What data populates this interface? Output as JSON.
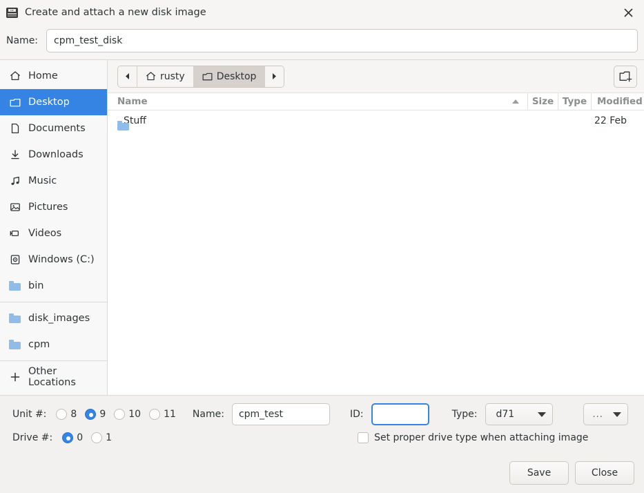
{
  "window": {
    "title": "Create and attach a new disk image",
    "icon": "disk-drive-icon",
    "close_icon": "close-icon",
    "accent_color": "#3584e4"
  },
  "name_row": {
    "label": "Name:",
    "value": "cpm_test_disk",
    "placeholder": ""
  },
  "sidebar": {
    "groups": [
      {
        "items": [
          {
            "label": "Home",
            "icon": "home-icon",
            "selected": false
          },
          {
            "label": "Desktop",
            "icon": "folder-outline-icon",
            "selected": true
          },
          {
            "label": "Documents",
            "icon": "document-icon",
            "selected": false
          },
          {
            "label": "Downloads",
            "icon": "download-icon",
            "selected": false
          },
          {
            "label": "Music",
            "icon": "music-note-icon",
            "selected": false
          },
          {
            "label": "Pictures",
            "icon": "picture-icon",
            "selected": false
          },
          {
            "label": "Videos",
            "icon": "video-camera-icon",
            "selected": false
          },
          {
            "label": "Windows (C:)",
            "icon": "drive-icon",
            "selected": false
          },
          {
            "label": "bin",
            "icon": "folder-icon",
            "selected": false
          }
        ]
      },
      {
        "items": [
          {
            "label": "disk_images",
            "icon": "folder-icon",
            "selected": false
          },
          {
            "label": "cpm",
            "icon": "folder-icon",
            "selected": false
          }
        ]
      },
      {
        "items": [
          {
            "label": "Other Locations",
            "icon": "plus-icon",
            "selected": false
          }
        ]
      }
    ]
  },
  "pathbar": {
    "back_icon": "chevron-left-icon",
    "forward_icon": "chevron-right-icon",
    "crumbs": [
      {
        "label": "rusty",
        "icon": "home-icon",
        "active": false
      },
      {
        "label": "Desktop",
        "icon": "folder-outline-icon",
        "active": true
      }
    ],
    "new_folder_icon": "new-folder-icon"
  },
  "filelist": {
    "columns": [
      {
        "key": "name",
        "label": "Name",
        "sorted": true,
        "sort_dir": "asc"
      },
      {
        "key": "size",
        "label": "Size"
      },
      {
        "key": "type",
        "label": "Type"
      },
      {
        "key": "modified",
        "label": "Modified"
      }
    ],
    "rows": [
      {
        "icon": "folder-icon",
        "name": "Stuff",
        "size": "",
        "type": "",
        "modified": "22 Feb"
      }
    ]
  },
  "options": {
    "unit": {
      "label": "Unit #:",
      "options": [
        "8",
        "9",
        "10",
        "11"
      ],
      "selected": "9"
    },
    "drive": {
      "label": "Drive #:",
      "options": [
        "0",
        "1"
      ],
      "selected": "0"
    },
    "image_name": {
      "label": "Name:",
      "value": "cpm_test",
      "placeholder": ""
    },
    "id": {
      "label": "ID:",
      "value": "",
      "placeholder": "",
      "focused": true
    },
    "type": {
      "label": "Type:",
      "value": "d71",
      "caret_icon": "chevron-down-icon"
    },
    "extra": {
      "value": "...",
      "caret_icon": "chevron-down-icon"
    },
    "proper_drive_type": {
      "label": "Set proper drive type when attaching image",
      "checked": false
    }
  },
  "actions": {
    "save_label": "Save",
    "close_label": "Close"
  }
}
